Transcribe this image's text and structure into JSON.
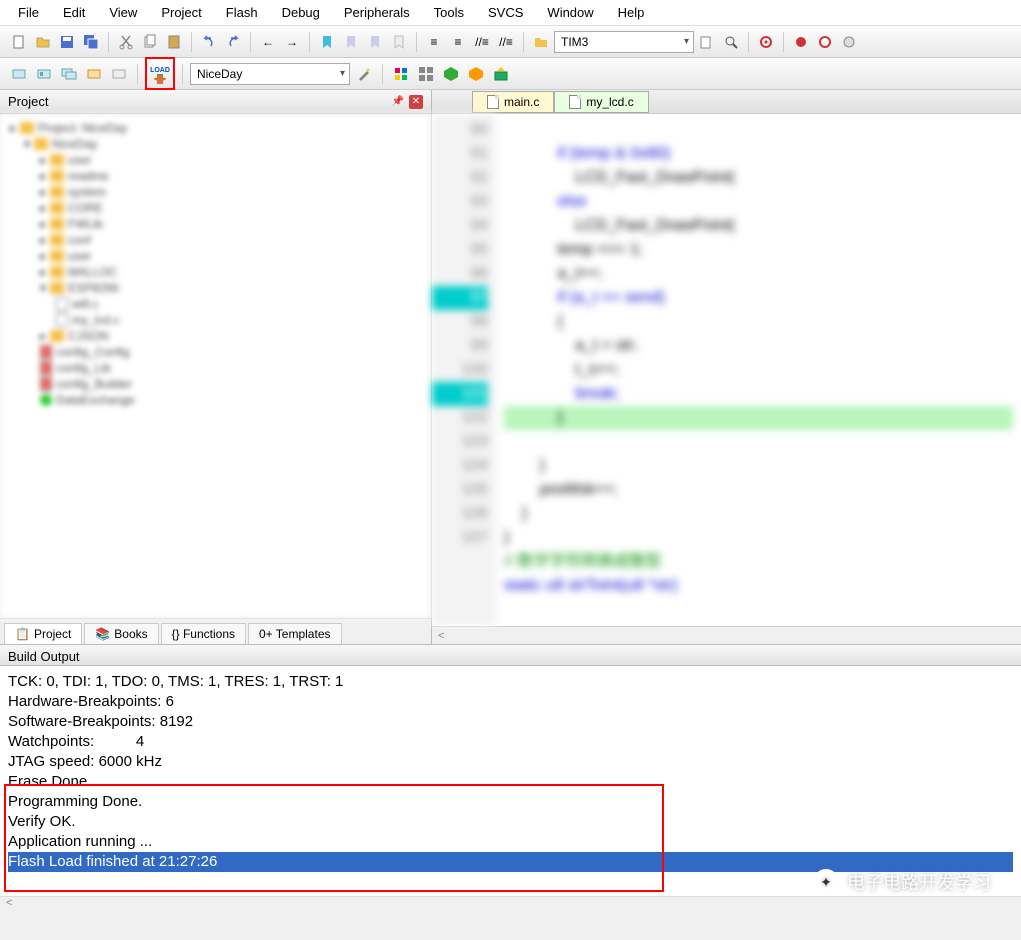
{
  "menu": [
    "File",
    "Edit",
    "View",
    "Project",
    "Flash",
    "Debug",
    "Peripherals",
    "Tools",
    "SVCS",
    "Window",
    "Help"
  ],
  "toolbar1_combo": "TIM3",
  "toolbar2_target": "NiceDay",
  "load_label": "LOAD",
  "project_panel": "Project",
  "proj_tabs": [
    {
      "icon": "proj",
      "label": "Project"
    },
    {
      "icon": "books",
      "label": "Books"
    },
    {
      "icon": "func",
      "label": "{} Functions"
    },
    {
      "icon": "tmpl",
      "label": "0+ Templates"
    }
  ],
  "editor_tabs": [
    {
      "name": "main.c",
      "active": false
    },
    {
      "name": "my_lcd.c",
      "active": true
    }
  ],
  "code_lines": {
    "nums": [
      "90",
      "91",
      "92",
      "93",
      "94",
      "95",
      "96",
      "97",
      "98",
      "99",
      "100",
      "101",
      "102",
      "103",
      "104",
      "105",
      "106",
      "107"
    ],
    "text": [
      "            if (temp & 0x80)",
      "                LCD_Fast_DrawPoint(",
      "            else",
      "                LCD_Fast_DrawPoint(",
      "            temp <<= 1;",
      "            a_t++;",
      "            if (a_t >= send)",
      "            {",
      "                a_t = str;",
      "                t_s++;",
      "                break;",
      "            }",
      "        }",
      "        posMsk++;",
      "    }",
      "}",
      "// 数字字符转换成整型",
      "static u8 strToInt(u8 *str)"
    ]
  },
  "build_title": "Build Output",
  "build_lines": [
    "TCK: 0, TDI: 1, TDO: 0, TMS: 1, TRES: 1, TRST: 1",
    "Hardware-Breakpoints: 6",
    "Software-Breakpoints: 8192",
    "Watchpoints:          4",
    "JTAG speed: 6000 kHz",
    "",
    "Erase Done.",
    "Programming Done.",
    "Verify OK.",
    "Application running ...",
    "Flash Load finished at 21:27:26"
  ],
  "watermark": "电子电路开发学习"
}
